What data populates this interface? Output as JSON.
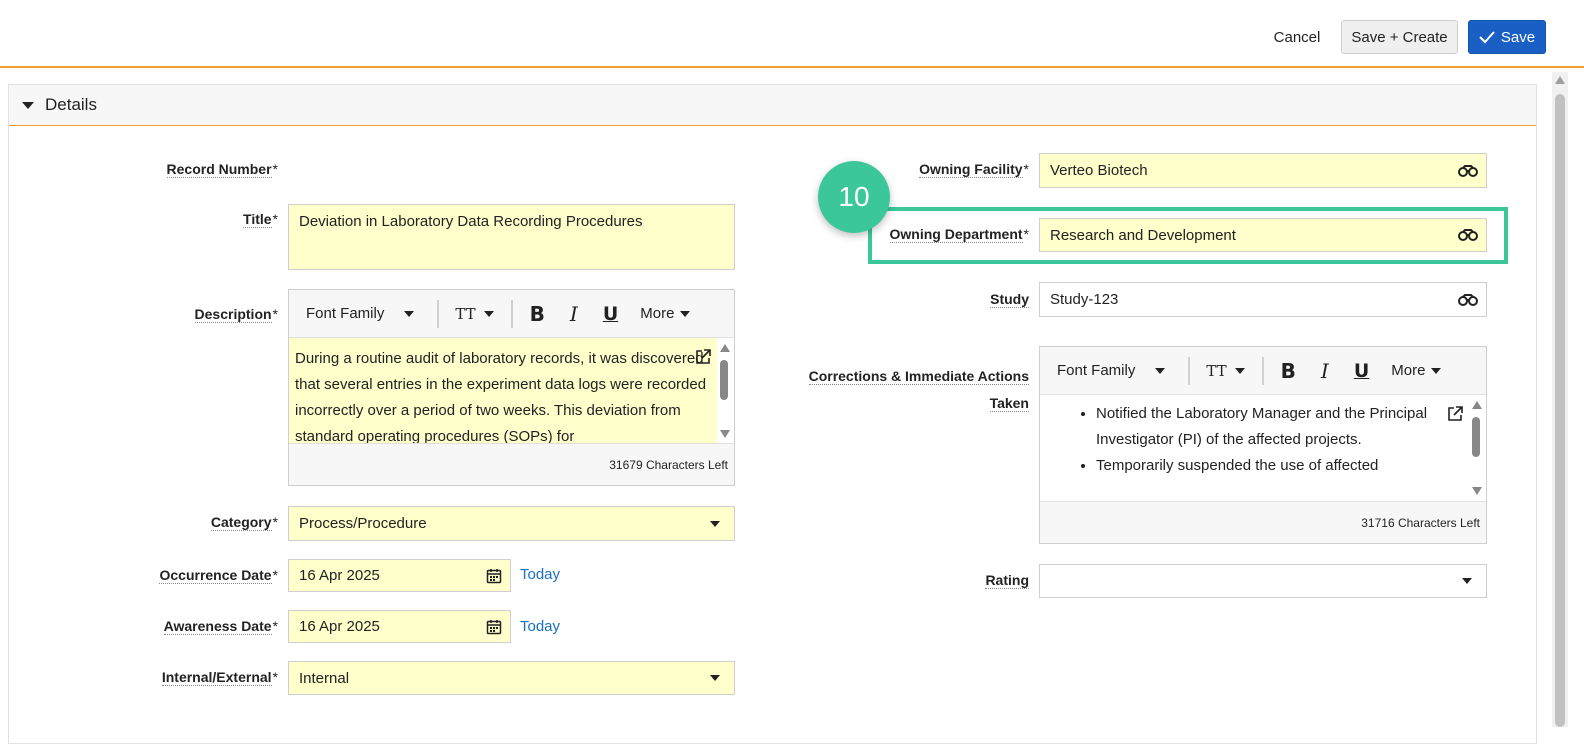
{
  "actions": {
    "cancel_label": "Cancel",
    "save_create_label": "Save + Create",
    "save_label": "Save"
  },
  "section": {
    "title": "Details"
  },
  "left": {
    "record_number": {
      "label": "Record Number",
      "req": "*"
    },
    "title": {
      "label": "Title",
      "req": "*",
      "value": "Deviation in Laboratory Data Recording Procedures"
    },
    "description": {
      "label": "Description",
      "req": "*",
      "toolbar": {
        "font_family": "Font Family",
        "text_size": "TT",
        "bold": "B",
        "italic": "I",
        "underline": "U",
        "more": "More"
      },
      "text": "During a routine audit of laboratory records, it was discovered that several entries in the experiment data logs were recorded incorrectly over a period of two weeks. This deviation from standard operating procedures (SOPs) for",
      "chars_left": "31679 Characters Left"
    },
    "category": {
      "label": "Category",
      "req": "*",
      "value": "Process/Procedure"
    },
    "occurrence_date": {
      "label": "Occurrence Date",
      "req": "*",
      "value": "16 Apr 2025",
      "today": "Today"
    },
    "awareness_date": {
      "label": "Awareness Date",
      "req": "*",
      "value": "16 Apr 2025",
      "today": "Today"
    },
    "internal_external": {
      "label": "Internal/External",
      "req": "*",
      "value": "Internal"
    }
  },
  "right": {
    "owning_facility": {
      "label": "Owning Facility",
      "req": "*",
      "value": "Verteo Biotech"
    },
    "owning_department": {
      "label": "Owning Department",
      "req": "*",
      "value": "Research and Development"
    },
    "study": {
      "label": "Study",
      "value": "Study-123"
    },
    "corrections": {
      "label_line1": "Corrections & Immediate Actions",
      "label_line2": "Taken",
      "toolbar": {
        "font_family": "Font Family",
        "text_size": "TT",
        "bold": "B",
        "italic": "I",
        "underline": "U",
        "more": "More"
      },
      "items": [
        "Notified the Laboratory Manager and the Principal Investigator (PI) of the affected projects.",
        "Temporarily suspended the use of affected"
      ],
      "chars_left": "31716 Characters Left"
    },
    "rating": {
      "label": "Rating",
      "value": ""
    }
  },
  "annotation": {
    "step_number": "10",
    "color": "#3cc79a"
  },
  "colors": {
    "accent": "#f0a030",
    "primary_button": "#1a5fc4",
    "required_field": "#ffffcc",
    "link": "#1a6fc4"
  }
}
